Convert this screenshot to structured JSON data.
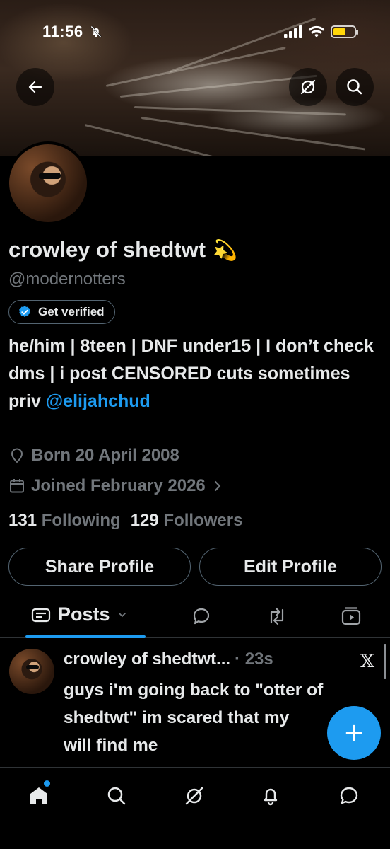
{
  "status_bar": {
    "time": "11:56"
  },
  "profile": {
    "display_name": "crowley of shedtwt",
    "name_emoji": "💫",
    "handle": "@modernotters",
    "verify_label": "Get verified",
    "bio_text": "he/him | 8teen | DNF under15 | I don’t check dms | i post CENSORED cuts sometimes",
    "bio_priv_prefix": "priv ",
    "bio_priv_link": "@elijahchud",
    "born": "Born 20 April 2008",
    "joined": "Joined February 2026",
    "following_count": "131",
    "following_label": "Following",
    "followers_count": "129",
    "followers_label": "Followers"
  },
  "actions": {
    "share": "Share Profile",
    "edit": "Edit Profile"
  },
  "tabs": {
    "posts_label": "Posts"
  },
  "post": {
    "name": "crowley of shedtwt...",
    "time": "· 23s",
    "text": "guys i'm going back to \"otter of shedtwt\" im scared that my ",
    "text_line3": "will find me"
  },
  "colors": {
    "accent": "#1d9bf0",
    "muted": "#71767b",
    "border": "#2f3336",
    "battery": "#ffd60a"
  },
  "icons": [
    "back-arrow-icon",
    "grok-icon",
    "search-icon",
    "bell-slash-icon",
    "signal-icon",
    "wifi-icon",
    "battery-icon",
    "location-icon",
    "calendar-icon",
    "chevron-right-icon",
    "verified-badge-icon",
    "posts-icon",
    "chevron-down-icon",
    "reply-icon",
    "retweet-icon",
    "video-icon",
    "x-logo-icon",
    "plus-icon",
    "home-icon",
    "search-nav-icon",
    "grok-nav-icon",
    "notifications-icon",
    "messages-icon"
  ]
}
